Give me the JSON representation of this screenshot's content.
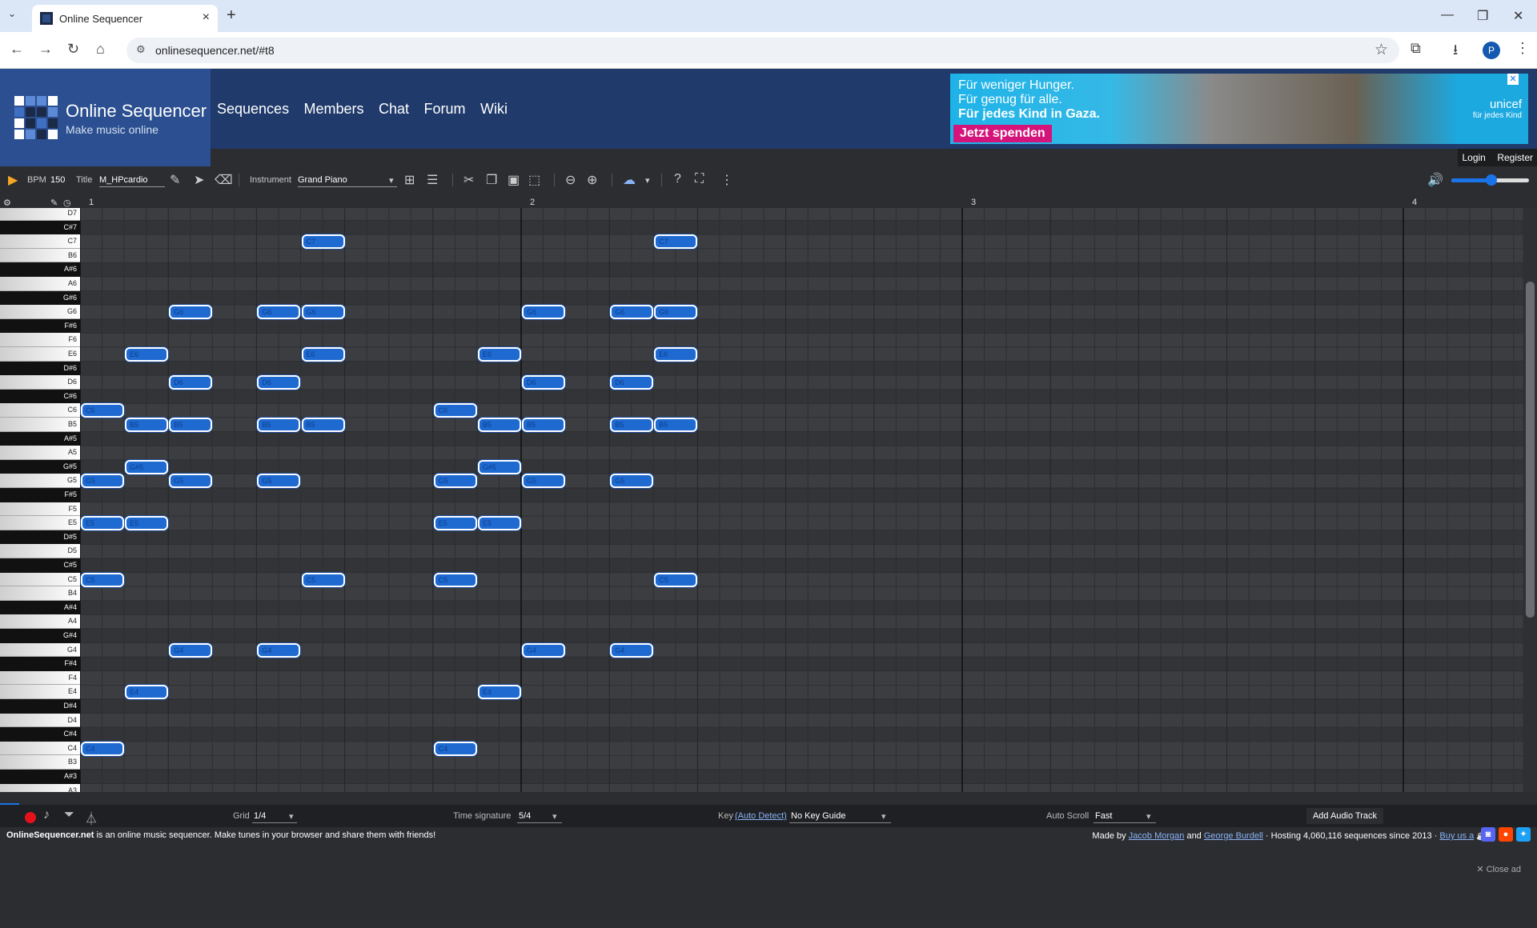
{
  "browser": {
    "tab_title": "Online Sequencer",
    "url": "onlinesequencer.net/#t8",
    "profile_initial": "P",
    "new_tab": "+",
    "close_tab": "×"
  },
  "site": {
    "name": "Online Sequencer",
    "tagline": "Make music online",
    "nav": [
      "Sequences",
      "Members",
      "Chat",
      "Forum",
      "Wiki"
    ],
    "login": "Login",
    "register": "Register"
  },
  "ad": {
    "lines": [
      "Für weniger Hunger.",
      "Für genug für alle.",
      "Für jedes Kind in Gaza."
    ],
    "cta": "Jetzt spenden",
    "brand": "unicef",
    "brand_sub": "für jedes Kind",
    "close": "✕"
  },
  "toolbar": {
    "bpm_label": "BPM",
    "bpm_value": "150",
    "title_label": "Title",
    "title_value": "M_HPcardio",
    "instrument_label": "Instrument",
    "instrument_value": "Grand Piano"
  },
  "ruler": [
    "1",
    "2",
    "3",
    "4"
  ],
  "keys": [
    "D7",
    "C#7",
    "C7",
    "B6",
    "A#6",
    "A6",
    "G#6",
    "G6",
    "F#6",
    "F6",
    "E6",
    "D#6",
    "D6",
    "C#6",
    "C6",
    "B5",
    "A#5",
    "A5",
    "G#5",
    "G5",
    "F#5",
    "F5",
    "E5",
    "D#5",
    "D5",
    "C#5",
    "C5",
    "B4",
    "A#4",
    "A4",
    "G#4",
    "G4",
    "F#4",
    "F4",
    "E4",
    "D#4",
    "D4",
    "C#4",
    "C4",
    "B3",
    "A#3",
    "A3",
    "G#3"
  ],
  "notes": [
    {
      "pitch": "C6",
      "step": 0
    },
    {
      "pitch": "G5",
      "step": 0
    },
    {
      "pitch": "E5",
      "step": 0
    },
    {
      "pitch": "C5",
      "step": 0
    },
    {
      "pitch": "C4",
      "step": 0
    },
    {
      "pitch": "E6",
      "step": 2
    },
    {
      "pitch": "B5",
      "step": 2
    },
    {
      "pitch": "G#5",
      "step": 2
    },
    {
      "pitch": "E5",
      "step": 2
    },
    {
      "pitch": "E4",
      "step": 2
    },
    {
      "pitch": "G6",
      "step": 4
    },
    {
      "pitch": "D6",
      "step": 4
    },
    {
      "pitch": "B5",
      "step": 4
    },
    {
      "pitch": "G5",
      "step": 4
    },
    {
      "pitch": "G4",
      "step": 4
    },
    {
      "pitch": "G6",
      "step": 8
    },
    {
      "pitch": "D6",
      "step": 8
    },
    {
      "pitch": "B5",
      "step": 8
    },
    {
      "pitch": "G5",
      "step": 8
    },
    {
      "pitch": "G4",
      "step": 8
    },
    {
      "pitch": "C7",
      "step": 10
    },
    {
      "pitch": "G6",
      "step": 10
    },
    {
      "pitch": "E6",
      "step": 10
    },
    {
      "pitch": "B5",
      "step": 10
    },
    {
      "pitch": "C5",
      "step": 10
    },
    {
      "pitch": "C6",
      "step": 16
    },
    {
      "pitch": "G5",
      "step": 16
    },
    {
      "pitch": "E5",
      "step": 16
    },
    {
      "pitch": "C5",
      "step": 16
    },
    {
      "pitch": "C4",
      "step": 16
    },
    {
      "pitch": "E6",
      "step": 18
    },
    {
      "pitch": "B5",
      "step": 18
    },
    {
      "pitch": "G#5",
      "step": 18
    },
    {
      "pitch": "E5",
      "step": 18
    },
    {
      "pitch": "E4",
      "step": 18
    },
    {
      "pitch": "G6",
      "step": 20
    },
    {
      "pitch": "D6",
      "step": 20
    },
    {
      "pitch": "B5",
      "step": 20
    },
    {
      "pitch": "G5",
      "step": 20
    },
    {
      "pitch": "G4",
      "step": 20
    },
    {
      "pitch": "G6",
      "step": 24
    },
    {
      "pitch": "D6",
      "step": 24
    },
    {
      "pitch": "B5",
      "step": 24
    },
    {
      "pitch": "G5",
      "step": 24
    },
    {
      "pitch": "G4",
      "step": 24
    },
    {
      "pitch": "C7",
      "step": 26
    },
    {
      "pitch": "G6",
      "step": 26
    },
    {
      "pitch": "E6",
      "step": 26
    },
    {
      "pitch": "B5",
      "step": 26
    },
    {
      "pitch": "C5",
      "step": 26
    }
  ],
  "bottom": {
    "grid_label": "Grid",
    "grid_value": "1/4",
    "timesig_label": "Time signature",
    "timesig_value": "5/4",
    "key_label": "Key",
    "key_autodetect": "(Auto Detect)",
    "key_value": "No Key Guide",
    "autoscroll_label": "Auto Scroll",
    "autoscroll_value": "Fast",
    "add_audio_track": "Add Audio Track"
  },
  "footer": {
    "site": "OnlineSequencer.net",
    "desc": " is an online music sequencer. Make tunes in your browser and share them with friends!",
    "made_by": "Made by ",
    "author1": "Jacob Morgan",
    "and": " and ",
    "author2": "George Burdell",
    "hosting": " · Hosting 4,060,116 sequences since 2013 · ",
    "buy": "Buy us a",
    "close_ad": "✕ Close ad"
  },
  "colors": {
    "note_fill": "#1e6ad1",
    "header_bg": "#203a6b",
    "accent": "#1a73e8",
    "record": "#e3121a"
  }
}
